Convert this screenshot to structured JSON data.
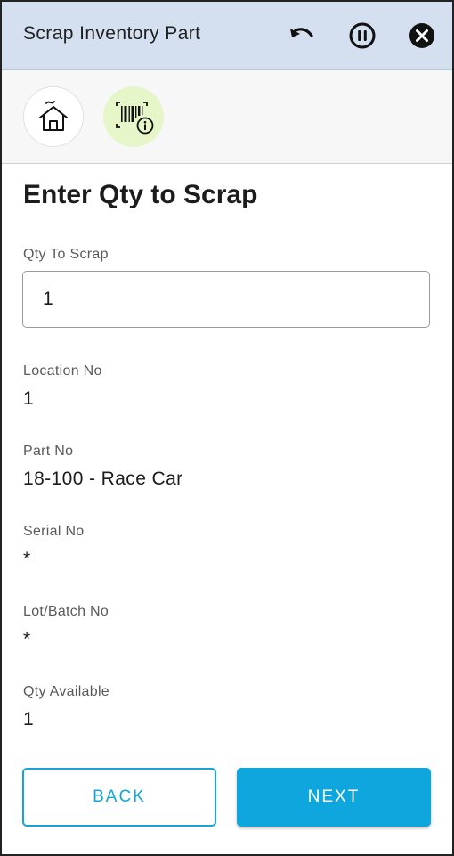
{
  "header": {
    "title": "Scrap Inventory Part",
    "icons": [
      "undo-icon",
      "pause-icon",
      "close-icon"
    ]
  },
  "toolbar": {
    "icons": [
      "home-icon",
      "barcode-info-icon"
    ],
    "accent_color": "#e6f6c9"
  },
  "main": {
    "page_title": "Enter Qty to Scrap",
    "qty_field": {
      "label": "Qty To Scrap",
      "value": "1"
    },
    "details": [
      {
        "label": "Location No",
        "value": "1"
      },
      {
        "label": "Part No",
        "value": "18-100 - Race Car"
      },
      {
        "label": "Serial No",
        "value": "*"
      },
      {
        "label": "Lot/Batch No",
        "value": "*"
      },
      {
        "label": "Qty Available",
        "value": "1"
      }
    ]
  },
  "footer": {
    "back_label": "BACK",
    "next_label": "NEXT",
    "primary_color": "#0ea6dd"
  }
}
